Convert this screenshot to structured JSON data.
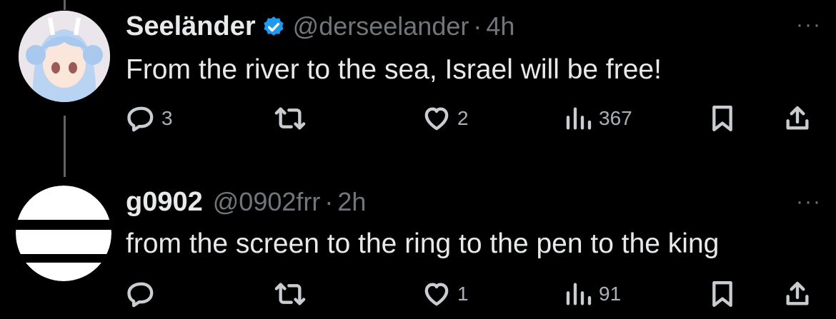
{
  "tweets": [
    {
      "name": "Seeländer",
      "verified": true,
      "handle": "@derseelander",
      "separator": "·",
      "time": "4h",
      "text": "From the river to the sea, Israel will be free!",
      "more_label": "···",
      "replies": "3",
      "retweets": "",
      "likes": "2",
      "views": "367"
    },
    {
      "name": "g0902",
      "verified": false,
      "handle": "@0902frr",
      "separator": "·",
      "time": "2h",
      "text": "from the screen to the ring to the pen to the king",
      "more_label": "···",
      "replies": "",
      "retweets": "",
      "likes": "1",
      "views": "91"
    }
  ],
  "colors": {
    "background": "#000000",
    "primary_text": "#e7e9ea",
    "secondary_text": "#71767b",
    "verified_blue": "#1d9bf0",
    "thread_line": "#5f6469"
  },
  "icons": [
    "reply-icon",
    "retweet-icon",
    "like-icon",
    "views-icon",
    "bookmark-icon",
    "share-icon",
    "verified-badge-icon",
    "more-icon"
  ]
}
